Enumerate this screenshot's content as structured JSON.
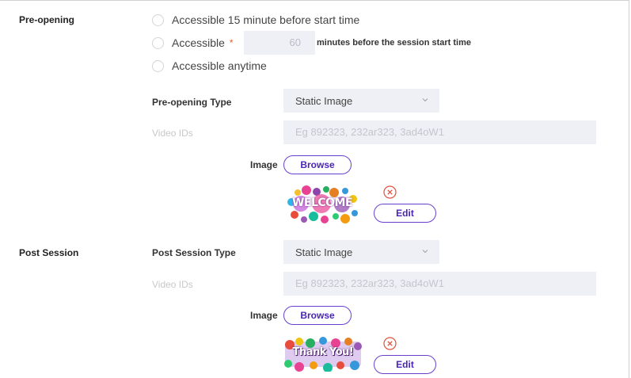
{
  "pre_opening": {
    "section_label": "Pre-opening",
    "radio_options": [
      {
        "label": "Accessible 15 minute before start time"
      },
      {
        "label": "Accessible",
        "required_mark": "*",
        "input_value": "60",
        "suffix": "minutes before the session start time"
      },
      {
        "label": "Accessible anytime"
      }
    ],
    "type_label": "Pre-opening Type",
    "type_value": "Static Image",
    "video_ids_label": "Video IDs",
    "video_ids_placeholder": "Eg 892323, 232ar323, 3ad4oW1",
    "image_label": "Image",
    "browse_label": "Browse",
    "edit_label": "Edit",
    "thumbnail_text": "WELCOME"
  },
  "post_session": {
    "section_label": "Post Session",
    "type_label": "Post Session Type",
    "type_value": "Static Image",
    "video_ids_label": "Video IDs",
    "video_ids_placeholder": "Eg 892323, 232ar323, 3ad4oW1",
    "image_label": "Image",
    "browse_label": "Browse",
    "edit_label": "Edit",
    "thumbnail_text": "Thank You!"
  },
  "colors": {
    "accent": "#6a3fd0",
    "danger": "#e0503a",
    "field_bg": "#eef0f5"
  }
}
